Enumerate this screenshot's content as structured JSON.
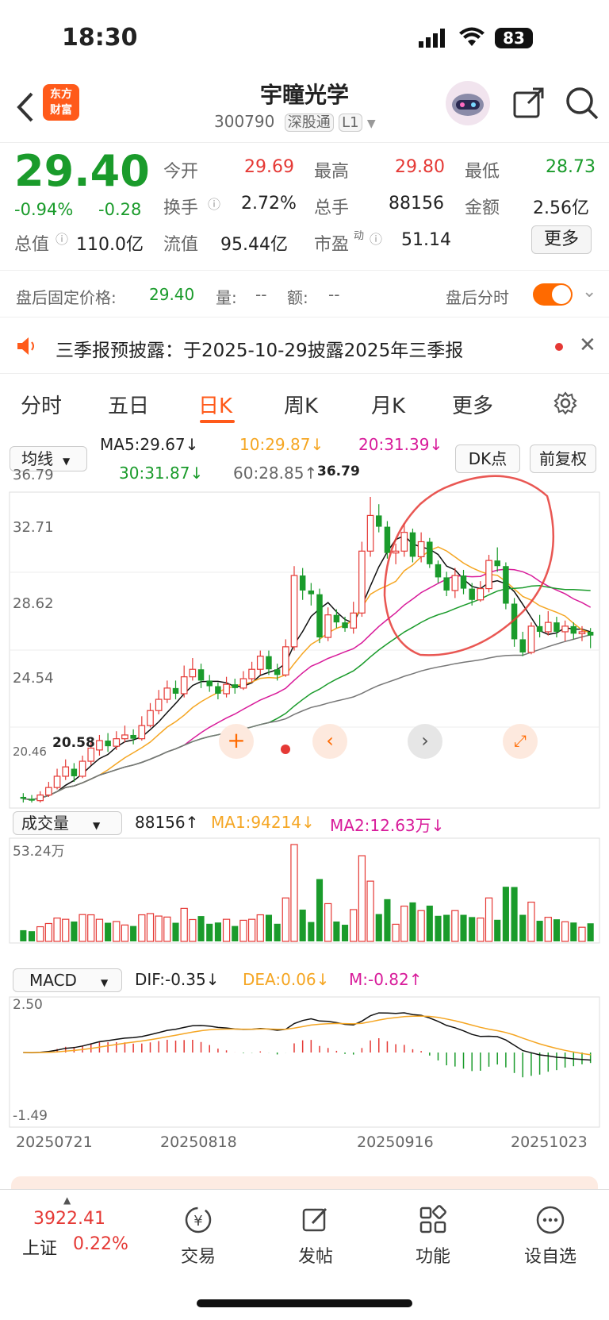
{
  "status": {
    "time": "18:30",
    "battery": "83"
  },
  "nav": {
    "logo_line1": "东方",
    "logo_line2": "财富",
    "title": "宇瞳光学",
    "code": "300790",
    "tag1": "深股通",
    "tag2": "L1"
  },
  "quote": {
    "price": "29.40",
    "pct": "-0.94%",
    "chg": "-0.28",
    "open_label": "今开",
    "open": "29.69",
    "high_label": "最高",
    "high": "29.80",
    "low_label": "最低",
    "low": "28.73",
    "turnover_label": "换手",
    "turnover": "2.72%",
    "vol_label": "总手",
    "vol": "88156",
    "amount_label": "金额",
    "amount": "2.56亿",
    "mcap_label": "总值",
    "mcap": "110.0亿",
    "float_label": "流值",
    "float": "95.44亿",
    "pe_label": "市盈",
    "pe_sup": "动",
    "pe": "51.14",
    "more": "更多"
  },
  "afterhours": {
    "label": "盘后固定价格:",
    "price": "29.40",
    "vol_label": "量:",
    "vol": "--",
    "amt_label": "额:",
    "amt": "--",
    "toggle_label": "盘后分时"
  },
  "notice": {
    "text": "三季报预披露：于2025-10-29披露2025年三季报"
  },
  "tabs": [
    "分时",
    "五日",
    "日K",
    "周K",
    "月K",
    "更多"
  ],
  "ma_bar": {
    "select": "均线",
    "ma5": "MA5:29.67↓",
    "ma10": "10:29.87↓",
    "ma20": "20:31.39↓",
    "ma30": "30:31.87↓",
    "ma60": "60:28.85↑",
    "dk": "DK点",
    "fq": "前复权"
  },
  "kline_axis": {
    "y1": "36.79",
    "y2": "32.71",
    "y3": "28.62",
    "y4": "24.54",
    "y5": "20.46",
    "max_label": "36.79",
    "min_label": "20.58"
  },
  "vol_bar": {
    "select": "成交量",
    "v": "88156↑",
    "ma1": "MA1:94214↓",
    "ma2": "MA2:12.63万↓",
    "max": "53.24万"
  },
  "macd_bar": {
    "select": "MACD",
    "dif": "DIF:-0.35↓",
    "dea": "DEA:0.06↓",
    "m": "M:-0.82↑",
    "top": "2.50",
    "bottom": "-1.49"
  },
  "dates": [
    "20250721",
    "20250818",
    "20250916",
    "20251023"
  ],
  "bottom": {
    "index_value": "3922.41",
    "index_name": "上证",
    "index_pct": "0.22%",
    "trade": "交易",
    "post": "发帖",
    "func": "功能",
    "custom": "设自选"
  },
  "colors": {
    "up": "#e53935",
    "down": "#1a9b2b",
    "accent": "#ff6a00"
  },
  "chart_data": {
    "type": "candlestick",
    "title": "宇瞳光学",
    "ylim": [
      20.46,
      36.79
    ],
    "candles": [
      [
        20.8,
        20.7,
        21.0,
        20.5
      ],
      [
        20.7,
        20.6,
        20.9,
        20.5
      ],
      [
        20.6,
        20.9,
        21.1,
        20.5
      ],
      [
        20.9,
        21.3,
        21.6,
        20.8
      ],
      [
        21.3,
        21.9,
        22.3,
        21.2
      ],
      [
        21.9,
        22.4,
        22.8,
        21.7
      ],
      [
        22.3,
        21.9,
        22.6,
        21.6
      ],
      [
        21.9,
        22.7,
        23.0,
        21.8
      ],
      [
        22.7,
        23.4,
        23.8,
        22.5
      ],
      [
        23.3,
        23.8,
        24.1,
        23.0
      ],
      [
        23.8,
        23.5,
        24.2,
        23.2
      ],
      [
        23.5,
        23.9,
        24.3,
        23.3
      ],
      [
        23.9,
        24.1,
        24.6,
        23.7
      ],
      [
        24.1,
        23.9,
        24.4,
        23.6
      ],
      [
        23.9,
        24.6,
        25.1,
        23.8
      ],
      [
        24.6,
        25.4,
        25.8,
        24.5
      ],
      [
        25.4,
        26.0,
        26.5,
        25.2
      ],
      [
        26.0,
        26.6,
        27.0,
        25.8
      ],
      [
        26.6,
        26.3,
        27.0,
        26.0
      ],
      [
        26.3,
        27.2,
        27.8,
        26.1
      ],
      [
        27.2,
        27.6,
        28.2,
        27.0
      ],
      [
        27.6,
        27.0,
        27.9,
        26.6
      ],
      [
        27.0,
        26.7,
        27.3,
        26.4
      ],
      [
        26.7,
        26.3,
        26.9,
        26.0
      ],
      [
        26.3,
        26.8,
        27.2,
        26.1
      ],
      [
        26.8,
        26.6,
        27.1,
        26.3
      ],
      [
        26.6,
        27.1,
        27.5,
        26.5
      ],
      [
        27.1,
        27.6,
        28.0,
        26.9
      ],
      [
        27.6,
        28.3,
        28.6,
        27.3
      ],
      [
        28.3,
        27.6,
        28.6,
        27.3
      ],
      [
        27.6,
        27.3,
        27.9,
        27.0
      ],
      [
        27.3,
        28.8,
        29.2,
        27.2
      ],
      [
        28.8,
        32.6,
        33.1,
        28.6
      ],
      [
        32.6,
        31.8,
        33.0,
        31.3
      ],
      [
        31.8,
        31.6,
        32.2,
        31.0
      ],
      [
        31.6,
        29.3,
        31.9,
        29.0
      ],
      [
        29.3,
        30.5,
        30.9,
        29.1
      ],
      [
        30.5,
        30.1,
        30.8,
        29.8
      ],
      [
        30.1,
        29.8,
        30.4,
        29.6
      ],
      [
        29.8,
        30.6,
        31.2,
        29.5
      ],
      [
        30.6,
        33.9,
        34.4,
        30.4
      ],
      [
        33.9,
        35.8,
        36.79,
        33.6
      ],
      [
        35.8,
        35.2,
        36.4,
        34.9
      ],
      [
        35.2,
        33.8,
        35.5,
        33.5
      ],
      [
        33.8,
        33.9,
        34.3,
        33.2
      ],
      [
        33.9,
        34.9,
        35.4,
        33.6
      ],
      [
        34.9,
        33.6,
        35.1,
        33.3
      ],
      [
        33.6,
        34.4,
        34.9,
        33.3
      ],
      [
        34.4,
        33.2,
        34.6,
        33.0
      ],
      [
        33.2,
        32.5,
        33.4,
        32.2
      ],
      [
        32.5,
        31.8,
        32.8,
        31.5
      ],
      [
        31.8,
        32.6,
        33.0,
        31.4
      ],
      [
        32.6,
        31.9,
        32.9,
        31.6
      ],
      [
        31.9,
        31.3,
        32.2,
        31.0
      ],
      [
        31.3,
        31.9,
        32.3,
        31.2
      ],
      [
        31.9,
        33.4,
        33.7,
        31.7
      ],
      [
        33.4,
        33.1,
        34.1,
        32.8
      ],
      [
        33.1,
        31.1,
        33.3,
        30.8
      ],
      [
        31.1,
        29.2,
        31.4,
        28.8
      ],
      [
        29.2,
        28.5,
        29.6,
        28.3
      ],
      [
        28.5,
        29.9,
        30.1,
        28.4
      ],
      [
        29.9,
        29.6,
        30.5,
        29.3
      ],
      [
        29.6,
        30.1,
        30.7,
        29.4
      ],
      [
        30.1,
        29.6,
        30.4,
        29.3
      ],
      [
        29.6,
        29.9,
        30.2,
        29.1
      ],
      [
        29.9,
        29.5,
        30.1,
        29.2
      ],
      [
        29.5,
        29.6,
        29.9,
        29.1
      ],
      [
        29.6,
        29.4,
        29.8,
        28.73
      ]
    ]
  }
}
